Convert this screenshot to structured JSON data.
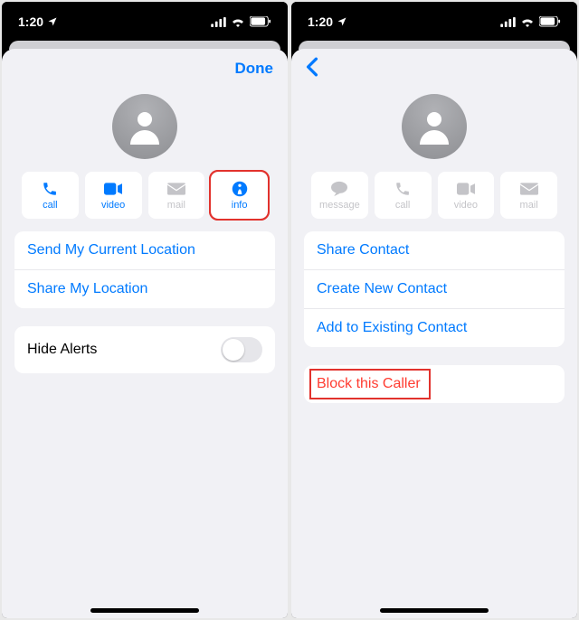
{
  "status": {
    "time": "1:20"
  },
  "left": {
    "done": "Done",
    "actions": {
      "call": "call",
      "video": "video",
      "mail": "mail",
      "info": "info"
    },
    "links": {
      "send_loc": "Send My Current Location",
      "share_loc": "Share My Location"
    },
    "hide_alerts": "Hide Alerts"
  },
  "right": {
    "actions": {
      "message": "message",
      "call": "call",
      "video": "video",
      "mail": "mail"
    },
    "links": {
      "share_contact": "Share Contact",
      "create_contact": "Create New Contact",
      "add_existing": "Add to Existing Contact"
    },
    "block": "Block this Caller"
  },
  "colors": {
    "accent": "#007aff",
    "danger": "#ff3b30",
    "highlight": "#e2322d"
  }
}
